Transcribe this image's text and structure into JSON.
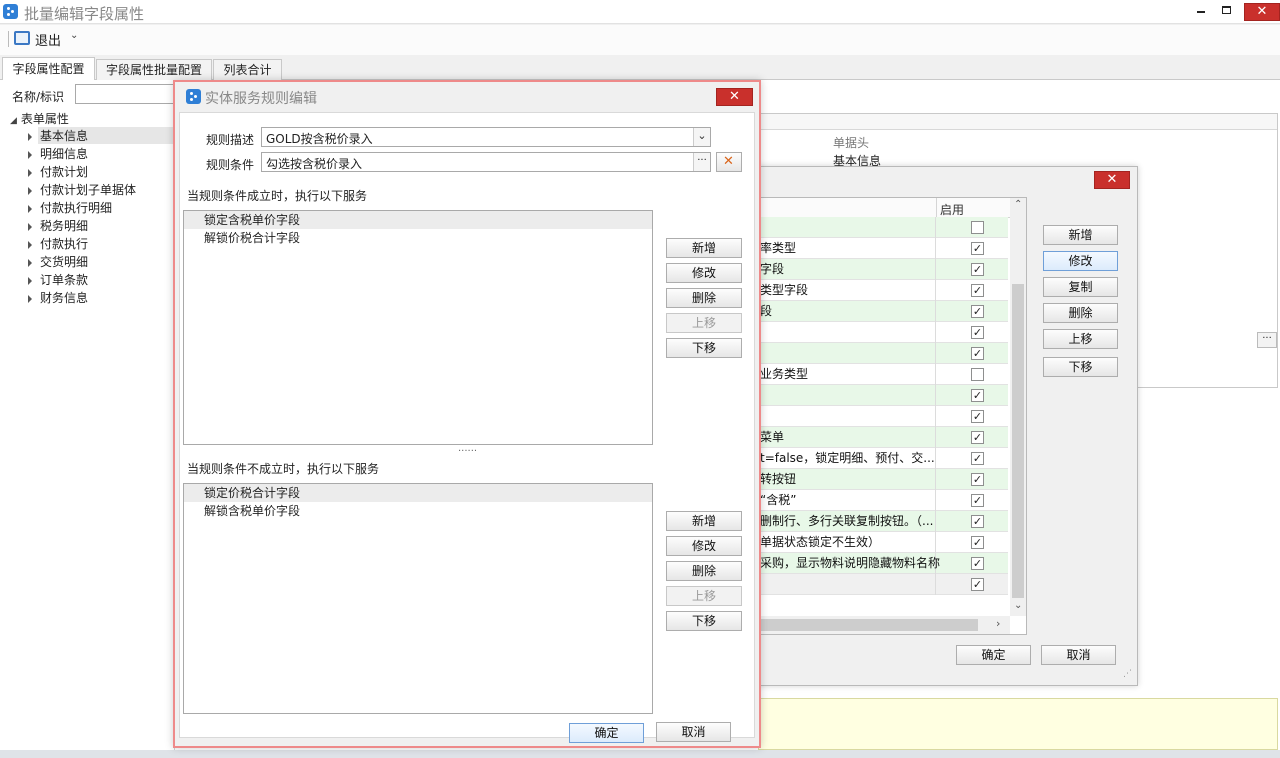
{
  "window": {
    "title": "批量编辑字段属性",
    "min_icon": "minimize-icon",
    "restore_icon": "restore-icon",
    "close_icon": "close-icon"
  },
  "toolbar": {
    "exit_label": "退出"
  },
  "tabs": [
    {
      "label": "字段属性配置"
    },
    {
      "label": "字段属性批量配置"
    },
    {
      "label": "列表合计"
    }
  ],
  "filter": {
    "label": "名称/标识",
    "value": ""
  },
  "tree": {
    "root": "表单属性",
    "items": [
      "基本信息",
      "明细信息",
      "付款计划",
      "付款计划子单据体",
      "付款执行明细",
      "税务明细",
      "付款执行",
      "交货明细",
      "订单条款",
      "财务信息"
    ]
  },
  "right_grid": {
    "header": "单据头",
    "row1": "基本信息"
  },
  "rule_list_dialog": {
    "enable_header": "启用",
    "rows": [
      {
        "text": "",
        "checked": false
      },
      {
        "text": "率类型",
        "checked": true
      },
      {
        "text": "字段",
        "checked": true
      },
      {
        "text": "类型字段",
        "checked": true
      },
      {
        "text": "段",
        "checked": true
      },
      {
        "text": "",
        "checked": true
      },
      {
        "text": "",
        "checked": true
      },
      {
        "text": "业务类型",
        "checked": false
      },
      {
        "text": "",
        "checked": true
      },
      {
        "text": "",
        "checked": true
      },
      {
        "text": "菜单",
        "checked": true
      },
      {
        "text": "t=false，锁定明细、预付、交...",
        "checked": true
      },
      {
        "text": "转按钮",
        "checked": true
      },
      {
        "text": "“含税”",
        "checked": true
      },
      {
        "text": "删制行、多行关联复制按钮。（...",
        "checked": true
      },
      {
        "text": "单据状态锁定不生效）",
        "checked": true
      },
      {
        "text": "采购，显示物料说明隐藏物料名称",
        "checked": true
      },
      {
        "text": "",
        "checked": true
      }
    ],
    "buttons": [
      "新增",
      "修改",
      "复制",
      "删除",
      "上移",
      "下移"
    ],
    "ok": "确定",
    "cancel": "取消"
  },
  "rule_edit_dialog": {
    "title": "实体服务规则编辑",
    "desc_label": "规则描述",
    "desc_value": "GOLD按含税价录入",
    "cond_label": "规则条件",
    "cond_value": "勾选按含税价录入",
    "ellipsis": "···",
    "true_section": "当规则条件成立时，执行以下服务",
    "true_items": [
      "锁定含税单价字段",
      "解锁价税合计字段"
    ],
    "false_section": "当规则条件不成立时，执行以下服务",
    "false_items": [
      "锁定价税合计字段",
      "解锁含税单价字段"
    ],
    "buttons": [
      "新增",
      "修改",
      "删除",
      "上移",
      "下移"
    ],
    "splitter": "......",
    "ok": "确定",
    "cancel": "取消"
  }
}
